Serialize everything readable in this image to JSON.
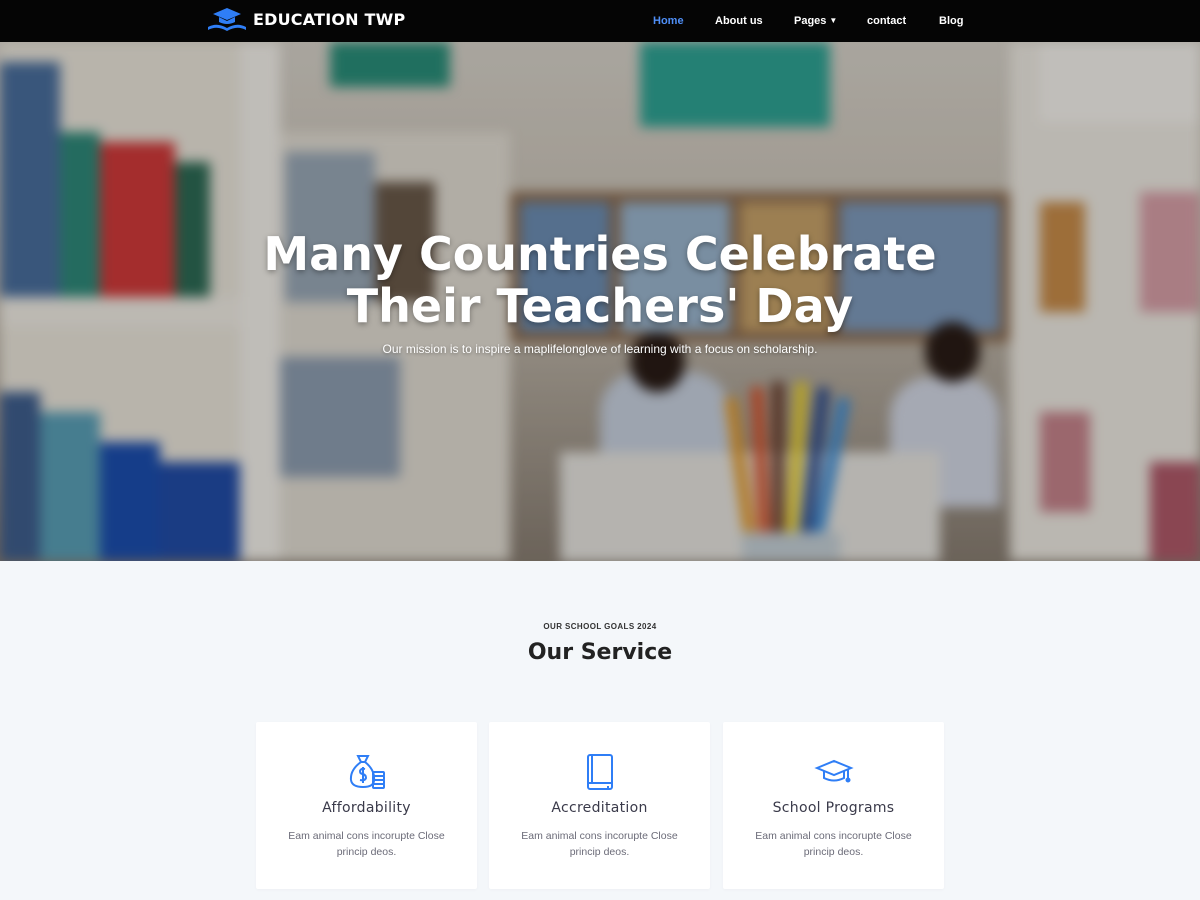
{
  "brand": {
    "name": "EDUCATION TWP",
    "accent_color": "#2f7ef6",
    "icon": "graduation-book-logo-icon"
  },
  "nav": {
    "items": [
      {
        "label": "Home",
        "active": true
      },
      {
        "label": "About us",
        "active": false
      },
      {
        "label": "Pages",
        "active": false,
        "has_dropdown": true,
        "icon": "chevron-down-icon"
      },
      {
        "label": "contact",
        "active": false
      },
      {
        "label": "Blog",
        "active": false
      }
    ]
  },
  "hero": {
    "title_line1": "Many Countries Celebrate",
    "title_line2": "Their Teachers' Day",
    "subtitle": "Our mission is to inspire a maplifelonglove of learning with a focus on scholarship."
  },
  "services": {
    "eyebrow": "OUR SCHOOL GOALS 2024",
    "title": "Our Service",
    "cards": [
      {
        "icon": "money-bag-icon",
        "title": "Affordability",
        "desc": "Eam animal cons incorupte Close princip deos."
      },
      {
        "icon": "book-icon",
        "title": "Accreditation",
        "desc": "Eam animal cons incorupte Close princip deos."
      },
      {
        "icon": "graduation-cap-icon",
        "title": "School Programs",
        "desc": "Eam animal cons incorupte Close princip deos."
      }
    ]
  }
}
